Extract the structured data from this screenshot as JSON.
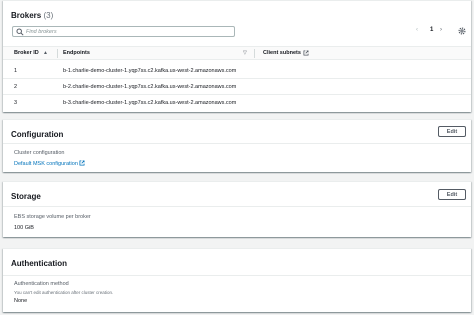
{
  "brokers": {
    "title": "Brokers",
    "count": "(3)",
    "search_placeholder": "Find brokers",
    "page_number": "1",
    "prev_glyph": "‹",
    "next_glyph": "›",
    "columns": {
      "broker_id": "Broker ID",
      "broker_id_sort": "▲",
      "endpoints": "Endpoints",
      "endpoints_sort": "▽",
      "client_subnets": "Client subnets"
    },
    "rows": [
      {
        "id": "1",
        "endpoint": "b-1.charlie-demo-cluster-1.yqp7ss.c2.kafka.us-west-2.amazonaws.com"
      },
      {
        "id": "2",
        "endpoint": "b-2.charlie-demo-cluster-1.yqp7ss.c2.kafka.us-west-2.amazonaws.com"
      },
      {
        "id": "3",
        "endpoint": "b-3.charlie-demo-cluster-1.yqp7ss.c2.kafka.us-west-2.amazonaws.com"
      }
    ]
  },
  "configuration": {
    "title": "Configuration",
    "edit_label": "Edit",
    "field_label": "Cluster configuration",
    "field_link": "Default MSK configuration"
  },
  "storage": {
    "title": "Storage",
    "edit_label": "Edit",
    "field_label": "EBS storage volume per broker",
    "field_value": "100 GiB"
  },
  "authentication": {
    "title": "Authentication",
    "field_label": "Authentication method",
    "note": "You can't edit authentication after cluster creation.",
    "field_value": "None"
  },
  "colors": {
    "link": "#0073bb",
    "page_background": "#f2f3f3",
    "header_background": "#fafafa"
  }
}
